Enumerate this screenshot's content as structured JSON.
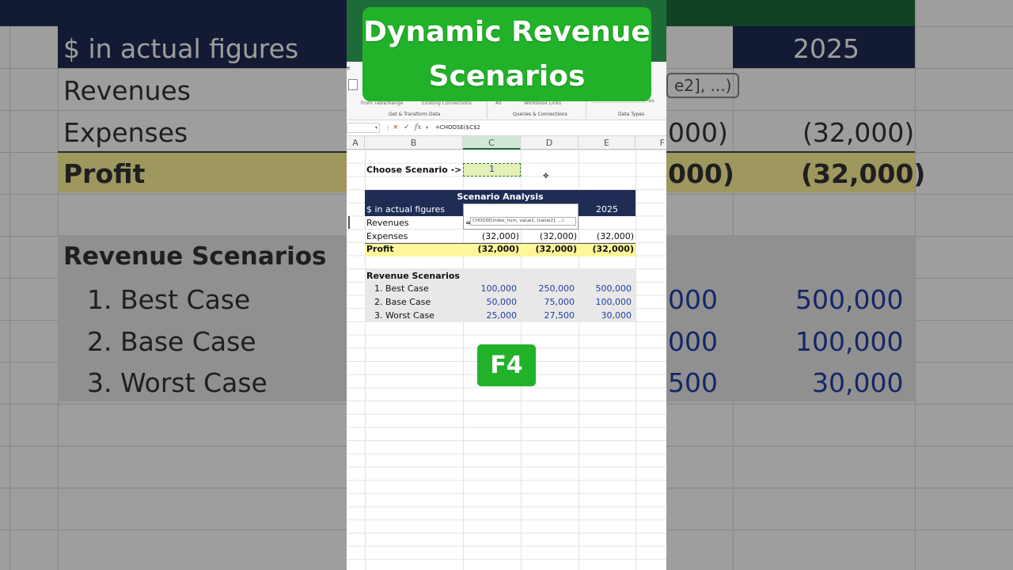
{
  "overlay": {
    "title_line1": "Dynamic Revenue",
    "title_line2": "Scenarios",
    "key_badge": "F4"
  },
  "ribbon": {
    "file_tab": "e",
    "item_partial_ribbon": "e2], ...)",
    "item_from_table": "From Table/Range",
    "item_existing_connections": "Existing Connections",
    "item_all": "All",
    "item_workbook_links": "Workbook Links",
    "item_ies": "ies",
    "group_get_transform": "Get & Transform Data",
    "group_queries": "Queries & Connections",
    "group_data_types": "Data Types"
  },
  "formula_bar": {
    "fx": "fx",
    "formula": "=CHOOSE($C$2",
    "cancel_icon": "×",
    "enter_icon": "✓"
  },
  "columns": [
    "A",
    "B",
    "C",
    "D",
    "E",
    "F"
  ],
  "sheet": {
    "choose_label": "Choose Scenario ->",
    "choose_value": "1",
    "table_title": "Scenario Analysis",
    "header_label": "$ in actual figures",
    "header_year_e": "2025",
    "edit_text": "=",
    "tooltip": "CHOOSE(index_num, value1, [value2], ...)",
    "rows": {
      "revenues": "Revenues",
      "expenses": "Expenses",
      "profit": "Profit"
    },
    "expenses_values": [
      "(32,000)",
      "(32,000)",
      "(32,000)"
    ],
    "profit_values": [
      "(32,000)",
      "(32,000)",
      "(32,000)"
    ],
    "scenarios_title": "Revenue Scenarios",
    "scenarios": [
      {
        "label": "1. Best Case",
        "values": [
          "100,000",
          "250,000",
          "500,000"
        ]
      },
      {
        "label": "2. Base Case",
        "values": [
          "50,000",
          "75,000",
          "100,000"
        ]
      },
      {
        "label": "3. Worst Case",
        "values": [
          "25,000",
          "27,500",
          "30,000"
        ]
      }
    ]
  },
  "background_left": {
    "header": "$ in actual figures",
    "revenues": "Revenues",
    "expenses": "Expenses",
    "profit": "Profit",
    "scenarios_title": "Revenue Scenarios",
    "best": "1. Best Case",
    "base": "2. Base Case",
    "worst": "3. Worst Case"
  },
  "background_right": {
    "year": "2025",
    "expenses_d": "000)",
    "expenses_e": "(32,000)",
    "profit_d": "000)",
    "profit_e": "(32,000)",
    "best_d": "000",
    "best_e": "500,000",
    "base_d": "000",
    "base_e": "100,000",
    "worst_d": "500",
    "worst_e": "30,000"
  },
  "colors": {
    "accent_green": "#22b22a",
    "table_header_navy": "#1f2d55",
    "profit_yellow": "#fff59a",
    "scenario_blue": "#1f3fa6"
  }
}
